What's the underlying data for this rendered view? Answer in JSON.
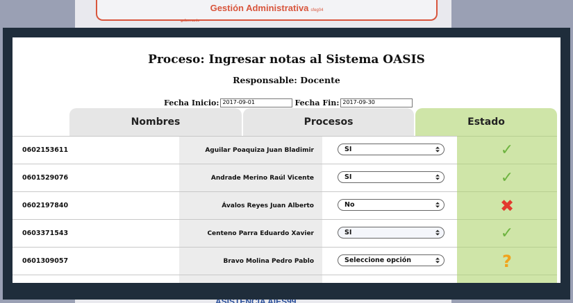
{
  "background": {
    "header_title": "Gestión Administrativa",
    "header_code": "sfeg04",
    "header_sub": "gobernante",
    "footer_text": "ASISTENCIA AIES99"
  },
  "dialog": {
    "title": "Proceso: Ingresar notas al Sistema OASIS",
    "responsable": "Responsable: Docente",
    "fecha_inicio_label": "Fecha Inicio:",
    "fecha_inicio_value": "2017-09-01",
    "fecha_fin_label": "Fecha Fin:",
    "fecha_fin_value": "2017-09-30",
    "columns": {
      "nombres": "Nombres",
      "procesos": "Procesos",
      "estado": "Estado"
    },
    "rows": [
      {
        "id": "0602153611",
        "name": "Aguilar Poaquiza Juan Bladimir",
        "selection": "SI",
        "status": "check-icon"
      },
      {
        "id": "0601529076",
        "name": "Andrade Merino Raúl Vicente",
        "selection": "SI",
        "status": "check-icon"
      },
      {
        "id": "0602197840",
        "name": "Ávalos Reyes Juan Alberto",
        "selection": "No",
        "status": "cross-icon"
      },
      {
        "id": "0603371543",
        "name": "Centeno Parra Eduardo Xavier",
        "selection": "SI",
        "status": "check-icon"
      },
      {
        "id": "0601309057",
        "name": "Bravo Molina Pedro Pablo",
        "selection": "Seleccione opción",
        "status": "question-icon"
      }
    ],
    "colors": {
      "estado_bg": "#cfe5a8",
      "check": "#6db33f",
      "cross": "#e23b2e",
      "question": "#f0a31c",
      "overlay": "#1f2d3b"
    }
  }
}
